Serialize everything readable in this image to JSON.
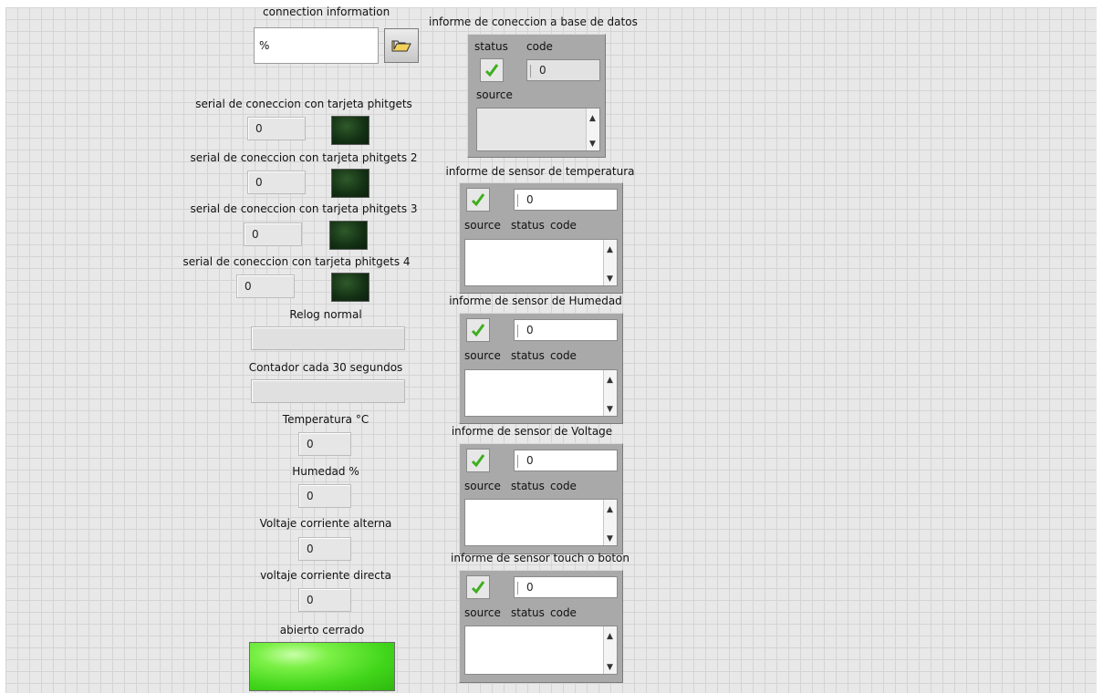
{
  "connection": {
    "label": "connection information",
    "path_value": "%"
  },
  "serials": [
    {
      "label": "serial de coneccion con tarjeta phitgets",
      "value": "0"
    },
    {
      "label": "serial de coneccion con tarjeta phitgets 2",
      "value": "0"
    },
    {
      "label": "serial de coneccion con tarjeta phitgets 3",
      "value": "0"
    },
    {
      "label": "serial de coneccion con tarjeta phitgets 4",
      "value": "0"
    }
  ],
  "relog": {
    "label": "Relog  normal"
  },
  "contador": {
    "label": "Contador cada 30 segundos"
  },
  "readings": [
    {
      "label": "Temperatura °C",
      "value": "0"
    },
    {
      "label": "Humedad %",
      "value": "0"
    },
    {
      "label": "Voltaje corriente alterna",
      "value": "0"
    },
    {
      "label": "voltaje corriente directa",
      "value": "0"
    }
  ],
  "abierto": {
    "label": "abierto cerrado"
  },
  "db_report": {
    "title": "informe de coneccion a base de datos",
    "status_label": "status",
    "code_label": "code",
    "code_value": "0",
    "source_label": "source"
  },
  "sensor_reports": [
    {
      "title": "informe de sensor de temperatura",
      "code_value": "0",
      "source_label": "source",
      "status_label": "status",
      "code_label": "code"
    },
    {
      "title": "informe de sensor de Humedad",
      "code_value": "0",
      "source_label": "source",
      "status_label": "status",
      "code_label": "code"
    },
    {
      "title": "informe de sensor de Voltage",
      "code_value": "0",
      "source_label": "source",
      "status_label": "status",
      "code_label": "code"
    },
    {
      "title": "informe de sensor touch o boton",
      "code_value": "0",
      "source_label": "source",
      "status_label": "status",
      "code_label": "code"
    }
  ],
  "colors": {
    "led_off": "#133014",
    "led_on": "#41d61a",
    "check_green": "#3fae1f",
    "cluster_bg": "#a9a9a9"
  },
  "icons": {
    "browse": "folder-open-icon",
    "status": "checkmark-icon",
    "scroll_up": "arrow-up-icon",
    "scroll_down": "arrow-down-icon"
  }
}
